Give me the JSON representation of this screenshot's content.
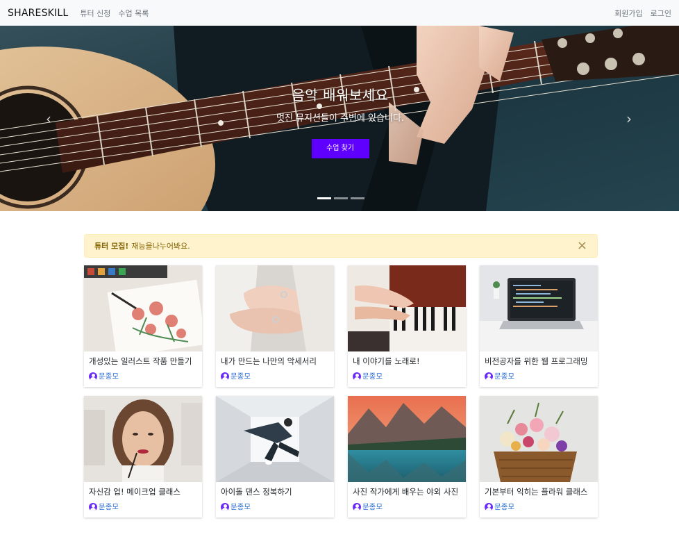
{
  "nav": {
    "brand": "SHARESKILL",
    "left_links": [
      "튜터 신청",
      "수업 목록"
    ],
    "right_links": [
      "회원가입",
      "로그인"
    ]
  },
  "hero": {
    "title": "음악 배워보세요",
    "subtitle": "멋진 뮤지션들이 주변에 있습니다.",
    "button": "수업 찾기",
    "prev_icon": "chevron-left-icon",
    "next_icon": "chevron-right-icon",
    "slides": 3,
    "active_slide": 0
  },
  "alert": {
    "strong": "튜터 모집!",
    "text": "재능을나누어봐요.",
    "close": "×"
  },
  "colors": {
    "primary_button": "#5f00ff",
    "alert_bg": "#fff3cd",
    "alert_text": "#856404",
    "tutor_link": "#2c6fd3",
    "avatar": "#6a2cf5"
  },
  "courses": [
    {
      "title": "개성있는 일러스트 작품 만들기",
      "tutor": "문종모",
      "image": "watercolor-flowers"
    },
    {
      "title": "내가 만드는 나만의 악세서리",
      "tutor": "문종모",
      "image": "bridal-hands-rings"
    },
    {
      "title": "내 이야기를 노래로!",
      "tutor": "문종모",
      "image": "piano-hands"
    },
    {
      "title": "비전공자를 위한 웹 프로그래밍",
      "tutor": "문종모",
      "image": "laptop-code"
    },
    {
      "title": "자신감 업! 메이크업 클래스",
      "tutor": "문종모",
      "image": "makeup-portrait"
    },
    {
      "title": "아이돌 댄스 정복하기",
      "tutor": "문종모",
      "image": "dancer-jump"
    },
    {
      "title": "사진 작가에게 배우는 야외 사진",
      "tutor": "문종모",
      "image": "mountain-lake"
    },
    {
      "title": "기본부터 익히는 플라워 클래스",
      "tutor": "문종모",
      "image": "flower-basket"
    }
  ]
}
